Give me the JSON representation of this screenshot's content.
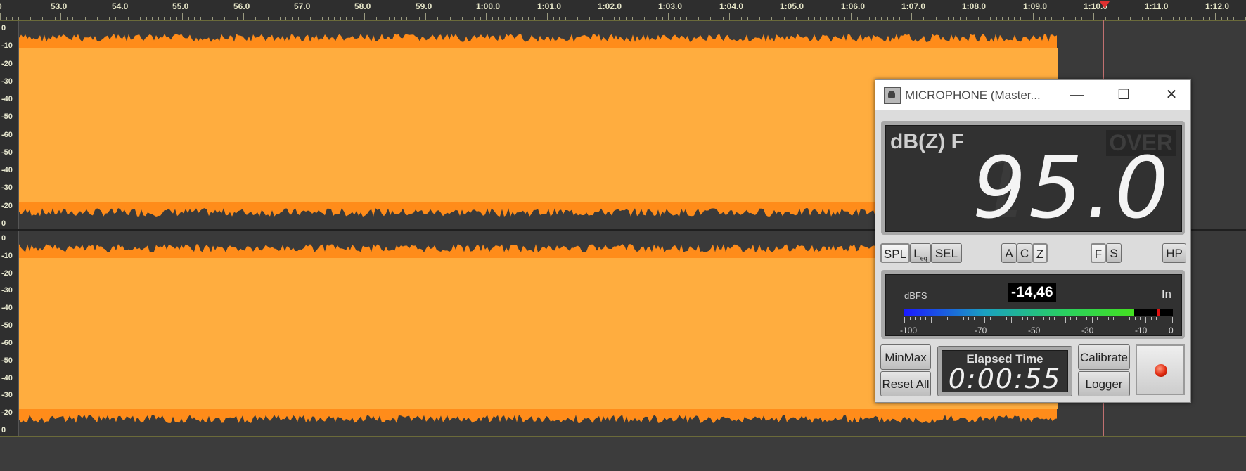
{
  "ruler": {
    "ticks": [
      "0",
      "53.0",
      "54.0",
      "55.0",
      "56.0",
      "57.0",
      "58.0",
      "59.0",
      "1:00.0",
      "1:01.0",
      "1:02.0",
      "1:03.0",
      "1:04.0",
      "1:05.0",
      "1:06.0",
      "1:07.0",
      "1:08.0",
      "1:09.0",
      "1:10.0",
      "1:11.0",
      "1:12.0"
    ]
  },
  "tracks": {
    "scale": [
      "0",
      "-10",
      "-20",
      "-30",
      "-40",
      "-50",
      "-60",
      "-50",
      "-40",
      "-30",
      "-20",
      "0"
    ]
  },
  "colors": {
    "waveform": "#ffad3f",
    "waveform_edge": "#ff8c1a",
    "background": "#3b3b3b"
  },
  "slm": {
    "title": "MICROPHONE (Master...",
    "window_buttons": {
      "minimize": "—",
      "maximize": "☐",
      "close": "✕"
    },
    "weighting": "dB(Z) F",
    "over": "OVER",
    "value": "95.0",
    "ghost_digit": "1",
    "buttons": {
      "spl": "SPL",
      "leq": "L",
      "leq_sub": "eq",
      "sel": "SEL",
      "a": "A",
      "c": "C",
      "z": "Z",
      "f": "F",
      "s": "S",
      "hp": "HP",
      "minmax": "MinMax",
      "reset_all": "Reset All",
      "calibrate": "Calibrate",
      "logger": "Logger"
    },
    "meter": {
      "unit": "dBFS",
      "value": "-14,46",
      "input": "In",
      "level_fraction": 0.855,
      "peak_fraction": 0.942,
      "scale": [
        "-100",
        "-70",
        "-50",
        "-30",
        "-10",
        "0"
      ]
    },
    "timer": {
      "label": "Elapsed Time",
      "value": "0:00:55"
    }
  }
}
